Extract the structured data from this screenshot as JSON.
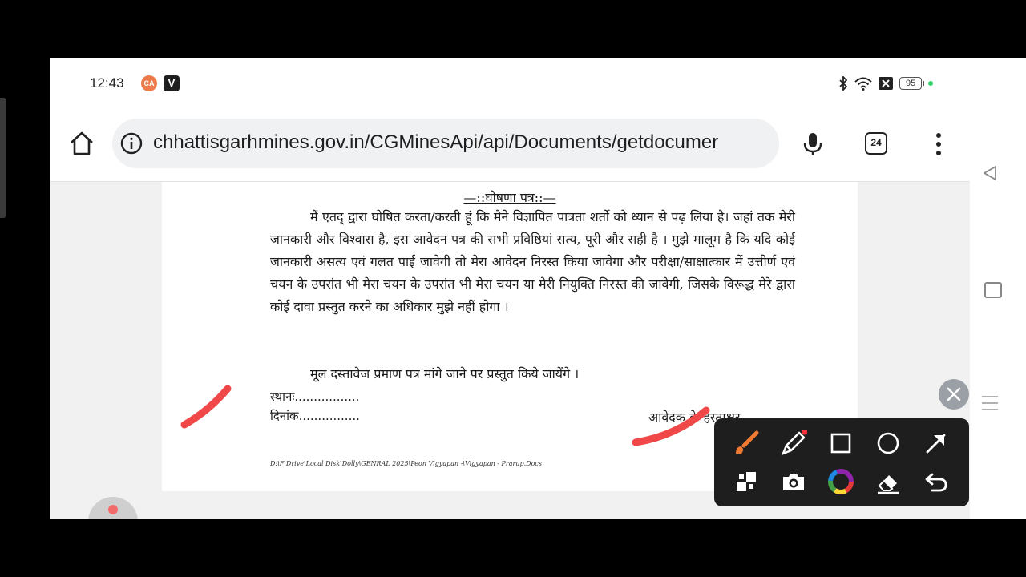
{
  "status_bar": {
    "time": "12:43",
    "notif_a_label": "CA",
    "notif_v_label": "V",
    "battery": "95",
    "icons": [
      "bluetooth-icon",
      "wifi-icon",
      "no-sim-icon"
    ]
  },
  "browser": {
    "url": "chhattisgarhmines.gov.in/CGMinesApi/api/Documents/getdocumer",
    "tab_count": "24"
  },
  "document": {
    "heading": "—::घोषणा पत्र::—",
    "paragraph_1": "मैं एतद् द्वारा घोषित करता/करती हूं कि मैने विज्ञापित पात्रता शर्तो को ध्यान से पढ़ लिया है। जहां तक मेरी जानकारी और विश्वास है, इस आवेदन पत्र की सभी प्रविष्ठियां सत्य, पूरी और सही है । मुझे मालूम है कि यदि कोई जानकारी असत्य एवं गलत पाई जावेगी तो मेरा आवेदन निरस्त किया जावेगा और परीक्षा/साक्षात्कार में उत्तीर्ण एवं चयन के उपरांत भी मेरा चयन के उपरांत भी मेरा चयन या मेरी नियुक्ति निरस्त की जावेगी, जिसके विरूद्ध मेरे द्वारा कोई दावा प्रस्तुत करने का अधिकार मुझे नहीं होगा ।",
    "paragraph_2": "मूल दस्तावेज प्रमाण पत्र मांगे जाने पर प्रस्तुत किये जायेंगे ।",
    "place_label": "स्थानः.................",
    "date_label": "दिनांक................",
    "signature_label": "आवेदक के हस्ताक्षर",
    "footer_path": "D:\\F Drive\\Local Disk\\Dolly\\GENRAL 2025\\Peon Vigyapan -\\Vigyapan - Prarup.Docs"
  },
  "colors": {
    "annotation_red": "#f04848",
    "brush_orange": "#f07a32",
    "status_green": "#35d36b"
  },
  "annotation_tools": [
    "brush-icon",
    "highlighter-icon",
    "rectangle-icon",
    "circle-icon",
    "arrow-icon",
    "mosaic-icon",
    "camera-icon",
    "color-wheel-icon",
    "eraser-icon",
    "undo-icon"
  ]
}
